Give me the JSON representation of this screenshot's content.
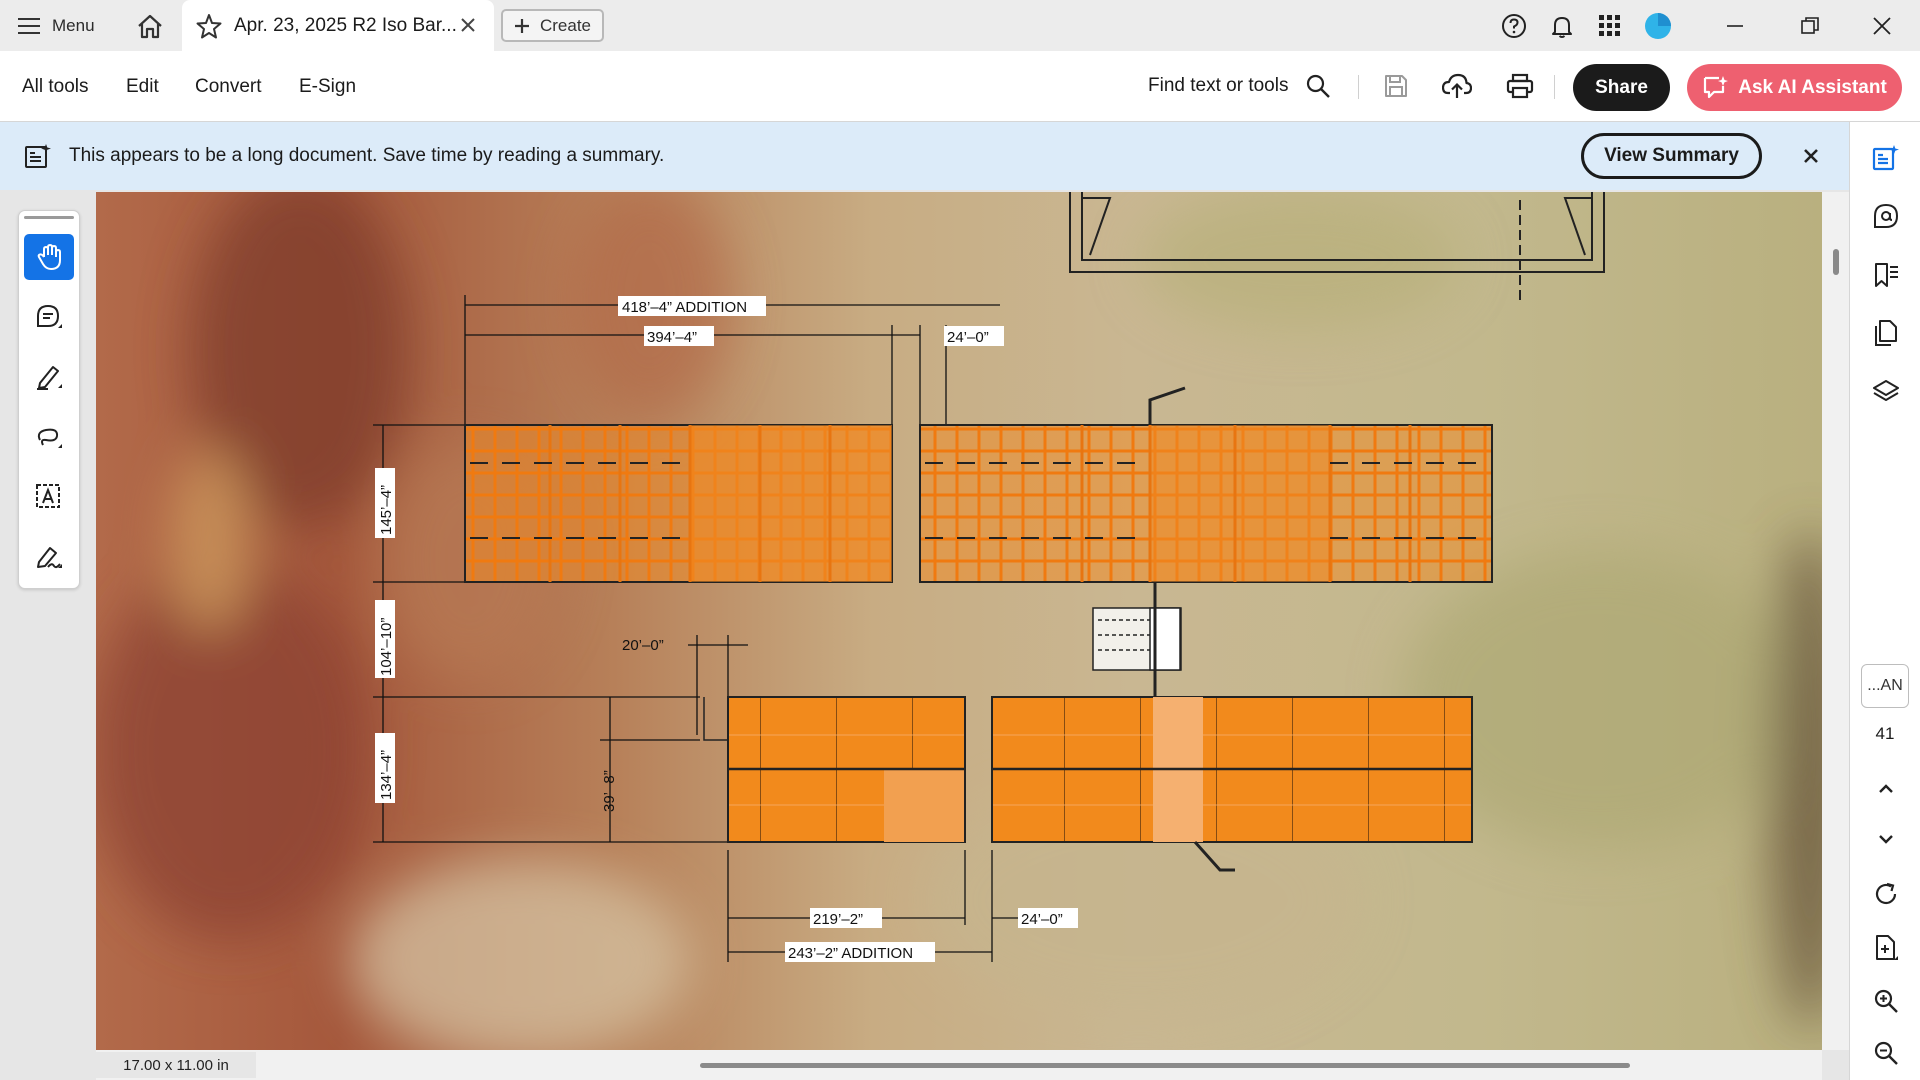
{
  "tabbar": {
    "menu_label": "Menu",
    "tab_title": "Apr. 23, 2025 R2 Iso Bar...",
    "create_label": "Create"
  },
  "toolbar": {
    "items": [
      "All tools",
      "Edit",
      "Convert",
      "E-Sign"
    ],
    "find_label": "Find text or tools",
    "share_label": "Share",
    "ask_ai_label": "Ask AI Assistant"
  },
  "banner": {
    "message": "This appears to be a long document. Save time by reading a summary.",
    "button_label": "View Summary"
  },
  "document": {
    "dimensions": {
      "top_total": "418’–4”  ADDITION",
      "top_left": "394’–4”",
      "top_right": "24’–0”",
      "left_upper": "145’–4”",
      "left_gap": "104’–10”",
      "left_lower": "134’–4”",
      "small_offset": "20’–0”",
      "lower_side": "39’–8”",
      "bottom_left": "219’–2”",
      "bottom_right": "24’–0”",
      "bottom_total": "243’–2”  ADDITION"
    },
    "page_size": "17.00 x 11.00 in"
  },
  "rightrail": {
    "page_label": "...AN",
    "page_number": "41"
  },
  "colors": {
    "accent_blue": "#1473e6",
    "share_bg": "#1b1b1b",
    "ai_button": "#ee6070",
    "banner_bg": "#dcebf9",
    "barn_orange": "#f08a24"
  }
}
